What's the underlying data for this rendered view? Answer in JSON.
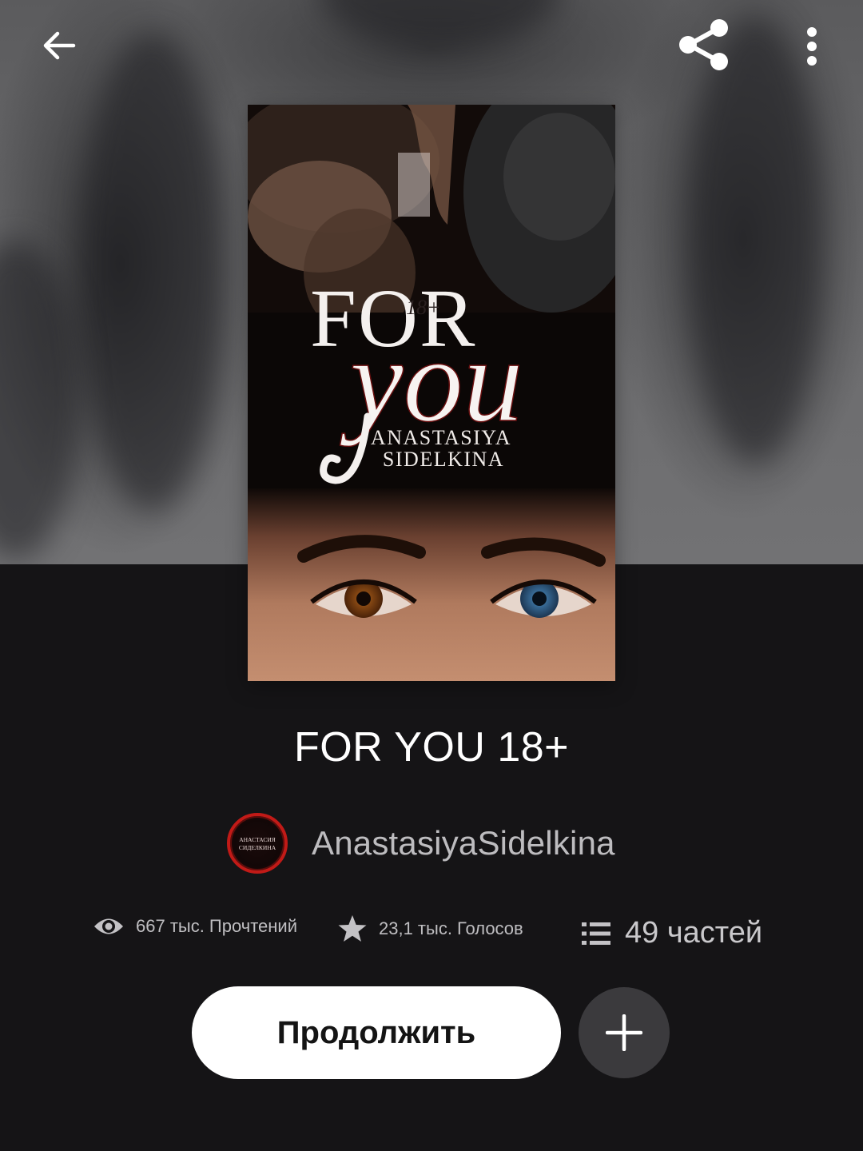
{
  "header": {
    "back_icon": "arrow-left-icon",
    "share_icon": "share-icon",
    "more_icon": "more-vertical-icon"
  },
  "cover": {
    "title_word_1": "FOR",
    "title_word_2": "you",
    "age_badge": "18+",
    "author_line_1": "ANASTASIYA",
    "author_line_2": "SIDELKINA"
  },
  "book": {
    "title": "FOR YOU 18+"
  },
  "author": {
    "name": "AnastasiyaSidelkina",
    "avatar_text_1": "АНАСТАСИЯ",
    "avatar_text_2": "СИДЕЛКИНА",
    "avatar_ring_color": "#c11a17"
  },
  "stats": {
    "reads": "667 тыс. Прочтений",
    "votes": "23,1 тыс. Голосов",
    "parts": "49 частей",
    "reads_icon": "eye-icon",
    "votes_icon": "star-icon",
    "parts_icon": "list-icon"
  },
  "actions": {
    "continue_label": "Продолжить",
    "add_icon": "plus-icon"
  }
}
